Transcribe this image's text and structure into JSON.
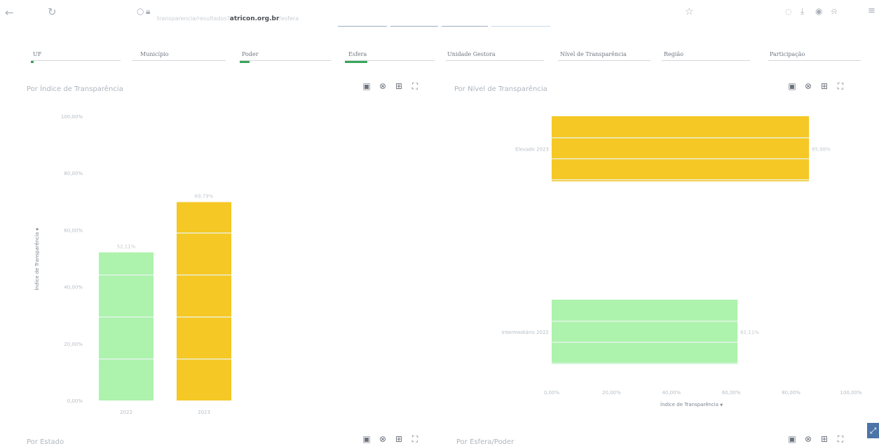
{
  "browser": {
    "back_icon": "arrow-left-icon",
    "reload_icon": "reload-icon",
    "url_prefix": "transparencia/resultados?",
    "url_host": "atricon.org.br",
    "url_suffix": "/esfera",
    "bookmark_icon": "star-icon"
  },
  "filters": [
    {
      "label": "UF"
    },
    {
      "label": "Município"
    },
    {
      "label": "Poder"
    },
    {
      "label": "Esfera"
    },
    {
      "label": "Unidade Gestora"
    },
    {
      "label": "Nível de Transparência"
    },
    {
      "label": "Região"
    },
    {
      "label": "Participação"
    }
  ],
  "panels": {
    "indice": {
      "title": "Por Índice de Transparência",
      "ylabel": "Índice de Transparência",
      "ylabel_arrow": "▼"
    },
    "nivel": {
      "title": "Por Nível de Transparência",
      "xlabel": "Índice de Transparência",
      "xlabel_arrow": "▼"
    },
    "estado": {
      "title": "Por Estado"
    },
    "esfera": {
      "title": "Por Esfera/Poder"
    }
  },
  "colors": {
    "green": "#adf2ad",
    "yellow": "#f5c825",
    "seam": "#e9f6f1"
  },
  "chart_data": [
    {
      "type": "bar",
      "orientation": "vertical",
      "title": "Por Índice de Transparência",
      "ylabel": "Índice de Transparência",
      "categories": [
        "2022",
        "2023"
      ],
      "series": [
        {
          "values": [
            52.11,
            69.79
          ]
        }
      ],
      "value_labels": [
        "52,11%",
        "69,79%"
      ],
      "bar_colors": [
        "#adf2ad",
        "#f5c825"
      ],
      "yticks": [
        "0,00%",
        "20,00%",
        "40,00%",
        "60,00%",
        "80,00%",
        "100,00%"
      ],
      "ylim": [
        0,
        100
      ]
    },
    {
      "type": "bar",
      "orientation": "horizontal",
      "title": "Por Nível de Transparência",
      "xlabel": "Índice de Transparência",
      "categories": [
        "Elevado  2023",
        "Intermediário  2022"
      ],
      "series": [
        {
          "values": [
            85.98,
            62.11
          ]
        }
      ],
      "value_labels": [
        "85,98%",
        "62,11%"
      ],
      "bar_colors": [
        "#f5c825",
        "#adf2ad"
      ],
      "xticks": [
        "0,00%",
        "20,00%",
        "40,00%",
        "60,00%",
        "80,00%",
        "100,00%"
      ],
      "xlim": [
        0,
        100
      ]
    }
  ]
}
